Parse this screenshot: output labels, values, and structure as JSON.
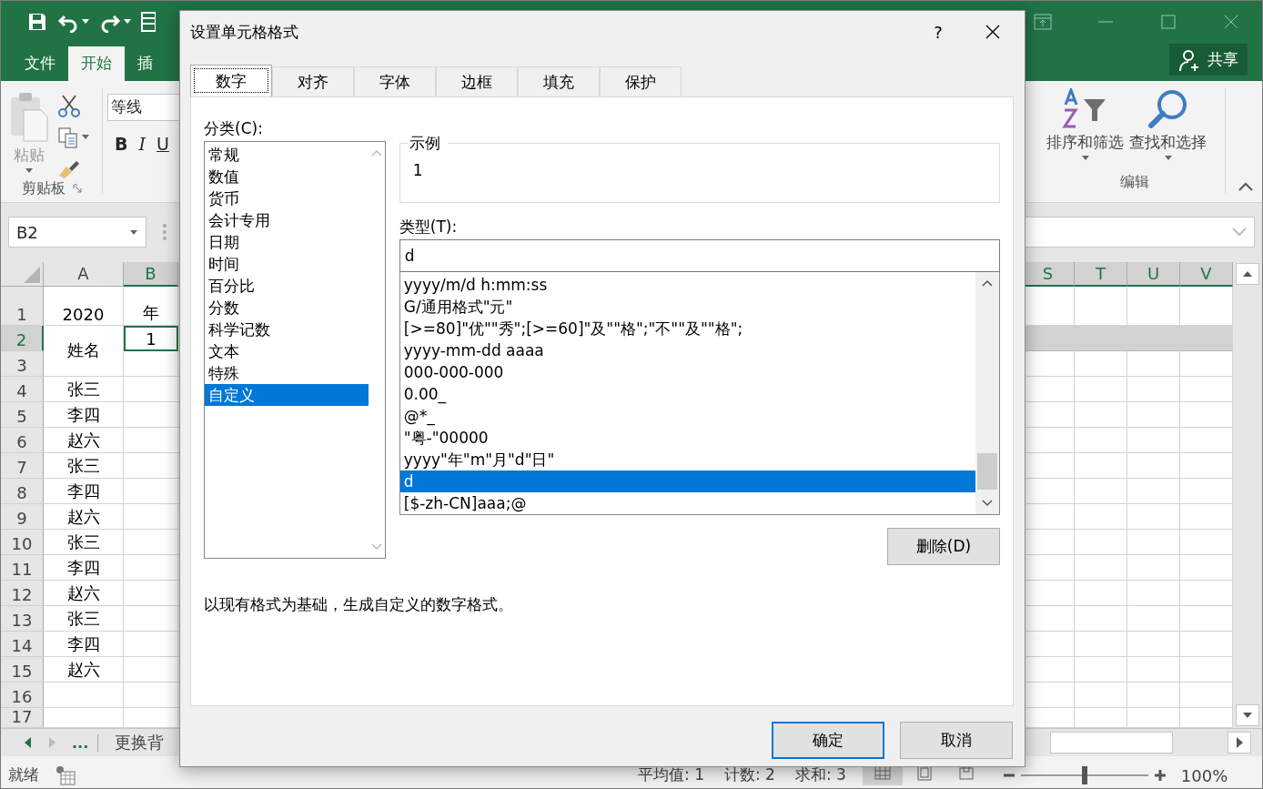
{
  "excel": {
    "ribbon_tabs": [
      {
        "label": "文件",
        "selected": false
      },
      {
        "label": "开始",
        "selected": true
      },
      {
        "label": "插",
        "selected": false
      }
    ],
    "share_button": "共享",
    "clipboard": {
      "paste": "粘贴",
      "group": "剪贴板"
    },
    "font": {
      "name": "等线",
      "styles": [
        "B",
        "I",
        "U"
      ]
    },
    "editing": {
      "sort": "排序和筛选",
      "find": "查找和选择",
      "group": "编辑"
    },
    "name_box": "B2",
    "columns_left": [
      {
        "label": "A",
        "selected": false
      },
      {
        "label": "B",
        "selected": true
      }
    ],
    "columns_right": [
      {
        "label": "S",
        "selected": true
      },
      {
        "label": "T",
        "selected": true
      },
      {
        "label": "U",
        "selected": true
      },
      {
        "label": "V",
        "selected": true
      }
    ],
    "rows": [
      {
        "header": "1",
        "a": "2020",
        "b": "年",
        "selected": false
      },
      {
        "header": "2",
        "a": "姓名",
        "merged": true,
        "b": "1",
        "selected": true
      },
      {
        "header": "3",
        "selected": false
      },
      {
        "header": "4",
        "a": "张三",
        "selected": false
      },
      {
        "header": "5",
        "a": "李四",
        "selected": false
      },
      {
        "header": "6",
        "a": "赵六",
        "selected": false
      },
      {
        "header": "7",
        "a": "张三",
        "selected": false
      },
      {
        "header": "8",
        "a": "李四",
        "selected": false
      },
      {
        "header": "9",
        "a": "赵六",
        "selected": false
      },
      {
        "header": "10",
        "a": "张三",
        "selected": false
      },
      {
        "header": "11",
        "a": "李四",
        "selected": false
      },
      {
        "header": "12",
        "a": "赵六",
        "selected": false
      },
      {
        "header": "13",
        "a": "张三",
        "selected": false
      },
      {
        "header": "14",
        "a": "李四",
        "selected": false
      },
      {
        "header": "15",
        "a": "赵六",
        "selected": false
      },
      {
        "header": "16",
        "selected": false
      },
      {
        "header": "17",
        "selected": false
      }
    ],
    "sheet_more": "...",
    "sheet_tab": "更换背",
    "status": {
      "ready": "就绪",
      "stats": [
        "平均值: 1",
        "计数: 2",
        "求和: 3"
      ],
      "zoom": "100%",
      "zoom_slider": {
        "level": 0.5
      }
    }
  },
  "dialog": {
    "title": "设置单元格格式",
    "help": "?",
    "tabs": [
      {
        "label": "数字",
        "selected": true
      },
      {
        "label": "对齐",
        "selected": false
      },
      {
        "label": "字体",
        "selected": false
      },
      {
        "label": "边框",
        "selected": false
      },
      {
        "label": "填充",
        "selected": false
      },
      {
        "label": "保护",
        "selected": false
      }
    ],
    "category_label": "分类(C):",
    "categories": [
      {
        "label": "常规",
        "selected": false
      },
      {
        "label": "数值",
        "selected": false
      },
      {
        "label": "货币",
        "selected": false
      },
      {
        "label": "会计专用",
        "selected": false
      },
      {
        "label": "日期",
        "selected": false
      },
      {
        "label": "时间",
        "selected": false
      },
      {
        "label": "百分比",
        "selected": false
      },
      {
        "label": "分数",
        "selected": false
      },
      {
        "label": "科学记数",
        "selected": false
      },
      {
        "label": "文本",
        "selected": false
      },
      {
        "label": "特殊",
        "selected": false
      },
      {
        "label": "自定义",
        "selected": true
      }
    ],
    "sample_label": "示例",
    "sample": "1",
    "type_label": "类型(T):",
    "type_value": "d",
    "types": [
      {
        "label": "yyyy/m/d h:mm:ss",
        "selected": false
      },
      {
        "label": "G/通用格式\"元\"",
        "selected": false
      },
      {
        "label": "[>=80]\"优\"\"秀\";[>=60]\"及\"\"格\";\"不\"\"及\"\"格\";",
        "selected": false
      },
      {
        "label": "yyyy-mm-dd aaaa",
        "selected": false
      },
      {
        "label": "000-000-000",
        "selected": false
      },
      {
        "label": "0.00_",
        "selected": false
      },
      {
        "label": "@*_",
        "selected": false
      },
      {
        "label": "\"粤-\"00000",
        "selected": false
      },
      {
        "label": "yyyy\"年\"m\"月\"d\"日\"",
        "selected": false
      },
      {
        "label": "d",
        "selected": true
      },
      {
        "label": "[$-zh-CN]aaa;@",
        "selected": false
      }
    ],
    "delete_button": "删除(D)",
    "description": "以现有格式为基础，生成自定义的数字格式。",
    "ok_button": "确定",
    "cancel_button": "取消"
  }
}
